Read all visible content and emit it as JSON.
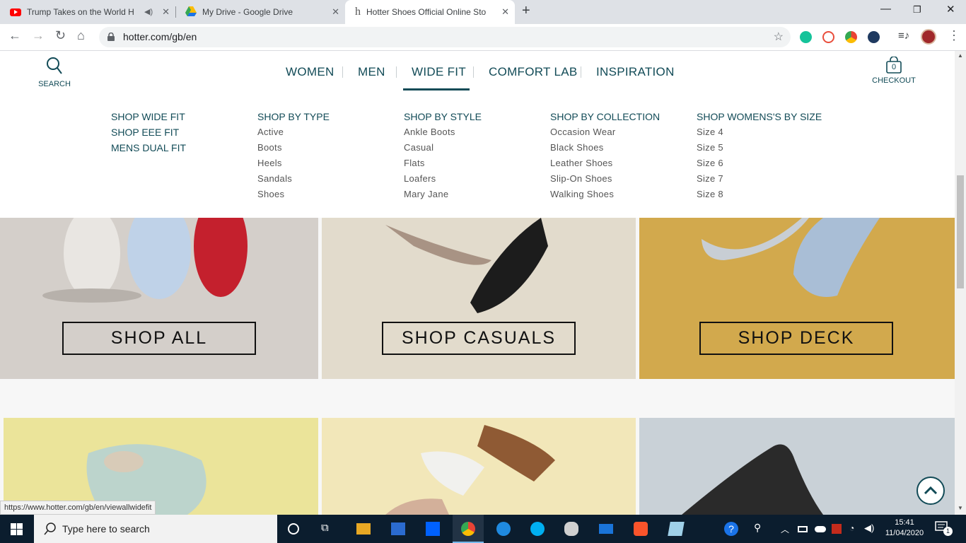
{
  "browser": {
    "tabs": [
      {
        "title": "Trump Takes on the World H",
        "favicon": "youtube-icon",
        "audio": true
      },
      {
        "title": "My Drive - Google Drive",
        "favicon": "google-drive-icon"
      },
      {
        "title": "Hotter Shoes Official Online Store",
        "favicon": "hotter-h-icon",
        "active": true
      }
    ],
    "url": "hotter.com/gb/en",
    "status_url": "https://www.hotter.com/gb/en/viewallwidefit"
  },
  "site": {
    "search_label": "SEARCH",
    "checkout_label": "CHECKOUT",
    "basket_count": "0",
    "nav": [
      "WOMEN",
      "MEN",
      "WIDE FIT",
      "COMFORT LAB",
      "INSPIRATION"
    ],
    "active_nav": "WIDE FIT",
    "accent_color": "#124b57"
  },
  "menu": {
    "col1": [
      "SHOP WIDE FIT",
      "SHOP EEE FIT",
      "MENS DUAL FIT"
    ],
    "col2": {
      "heading": "SHOP BY TYPE",
      "items": [
        "Active",
        "Boots",
        "Heels",
        "Sandals",
        "Shoes"
      ]
    },
    "col3": {
      "heading": "SHOP BY STYLE",
      "items": [
        "Ankle Boots",
        "Casual",
        "Flats",
        "Loafers",
        "Mary Jane"
      ]
    },
    "col4": {
      "heading": "SHOP BY COLLECTION",
      "items": [
        "Occasion Wear",
        "Black Shoes",
        "Leather Shoes",
        "Slip-On Shoes",
        "Walking Shoes"
      ]
    },
    "col5": {
      "heading": "SHOP WOMENS'S BY SIZE",
      "items": [
        "Size 4",
        "Size 5",
        "Size 6",
        "Size 7",
        "Size 8"
      ]
    }
  },
  "tiles": {
    "row1": [
      {
        "button": "SHOP ALL",
        "bg": "#d6d1cc"
      },
      {
        "button": "SHOP CASUALS",
        "bg": "#e3dccd"
      },
      {
        "button": "SHOP DECK",
        "bg": "#d3aa4e"
      }
    ],
    "row2_bg": [
      "#ece59a",
      "#f3e8b8",
      "#c8d0d6"
    ]
  },
  "taskbar": {
    "search_placeholder": "Type here to search",
    "time": "15:41",
    "date": "11/04/2020",
    "notification_count": "1"
  }
}
